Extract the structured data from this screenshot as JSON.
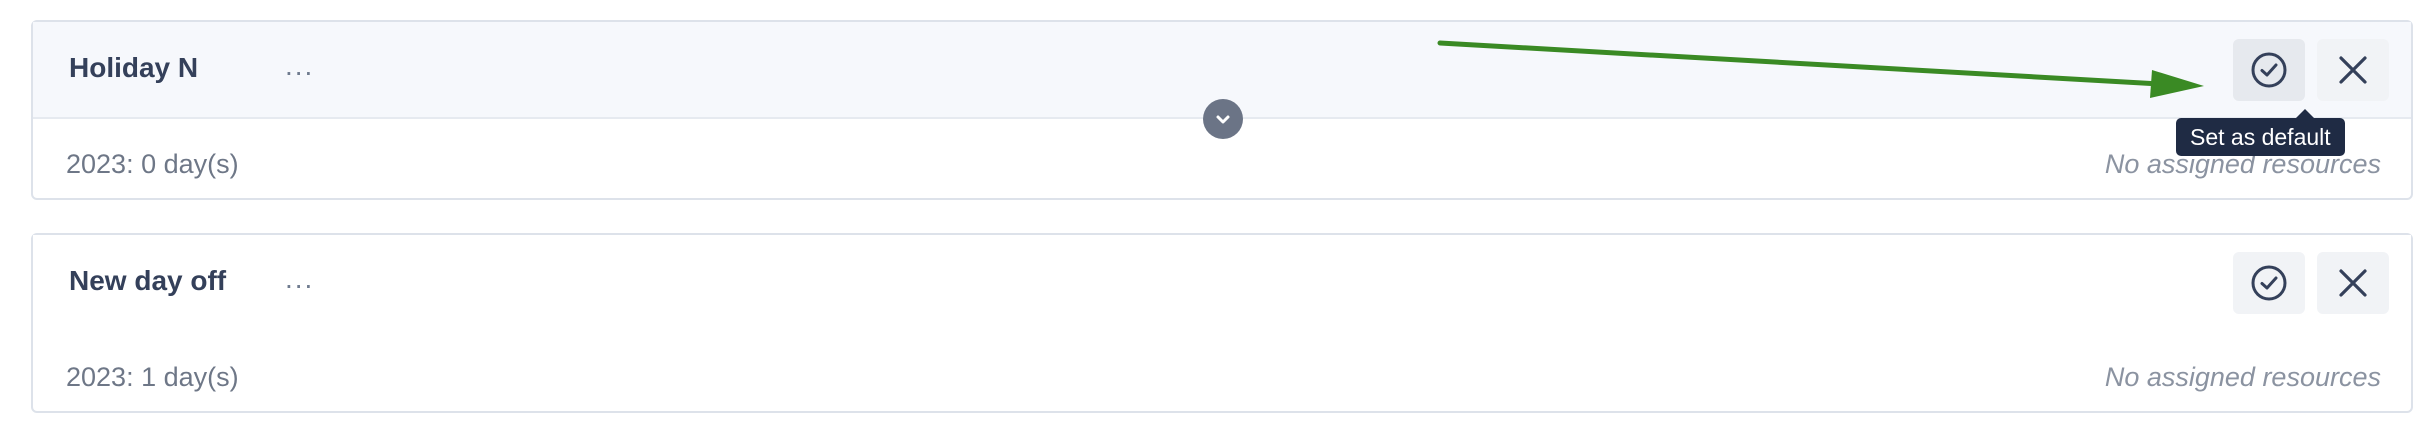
{
  "holidays": [
    {
      "name": "Holiday N",
      "more": "...",
      "year_summary": "2023: 0 day(s)",
      "resources": "No assigned resources"
    },
    {
      "name": "New day off",
      "more": "...",
      "year_summary": "2023: 1 day(s)",
      "resources": "No assigned resources"
    }
  ],
  "tooltip": {
    "text": "Set as default"
  },
  "icons": {
    "set_default": "check-circle-icon",
    "remove": "close-icon",
    "expand": "chevron-down-icon"
  },
  "colors": {
    "annotation_arrow": "#3a8a24",
    "tooltip_bg": "#1f2b44",
    "toggle_bg": "#6b7486"
  }
}
